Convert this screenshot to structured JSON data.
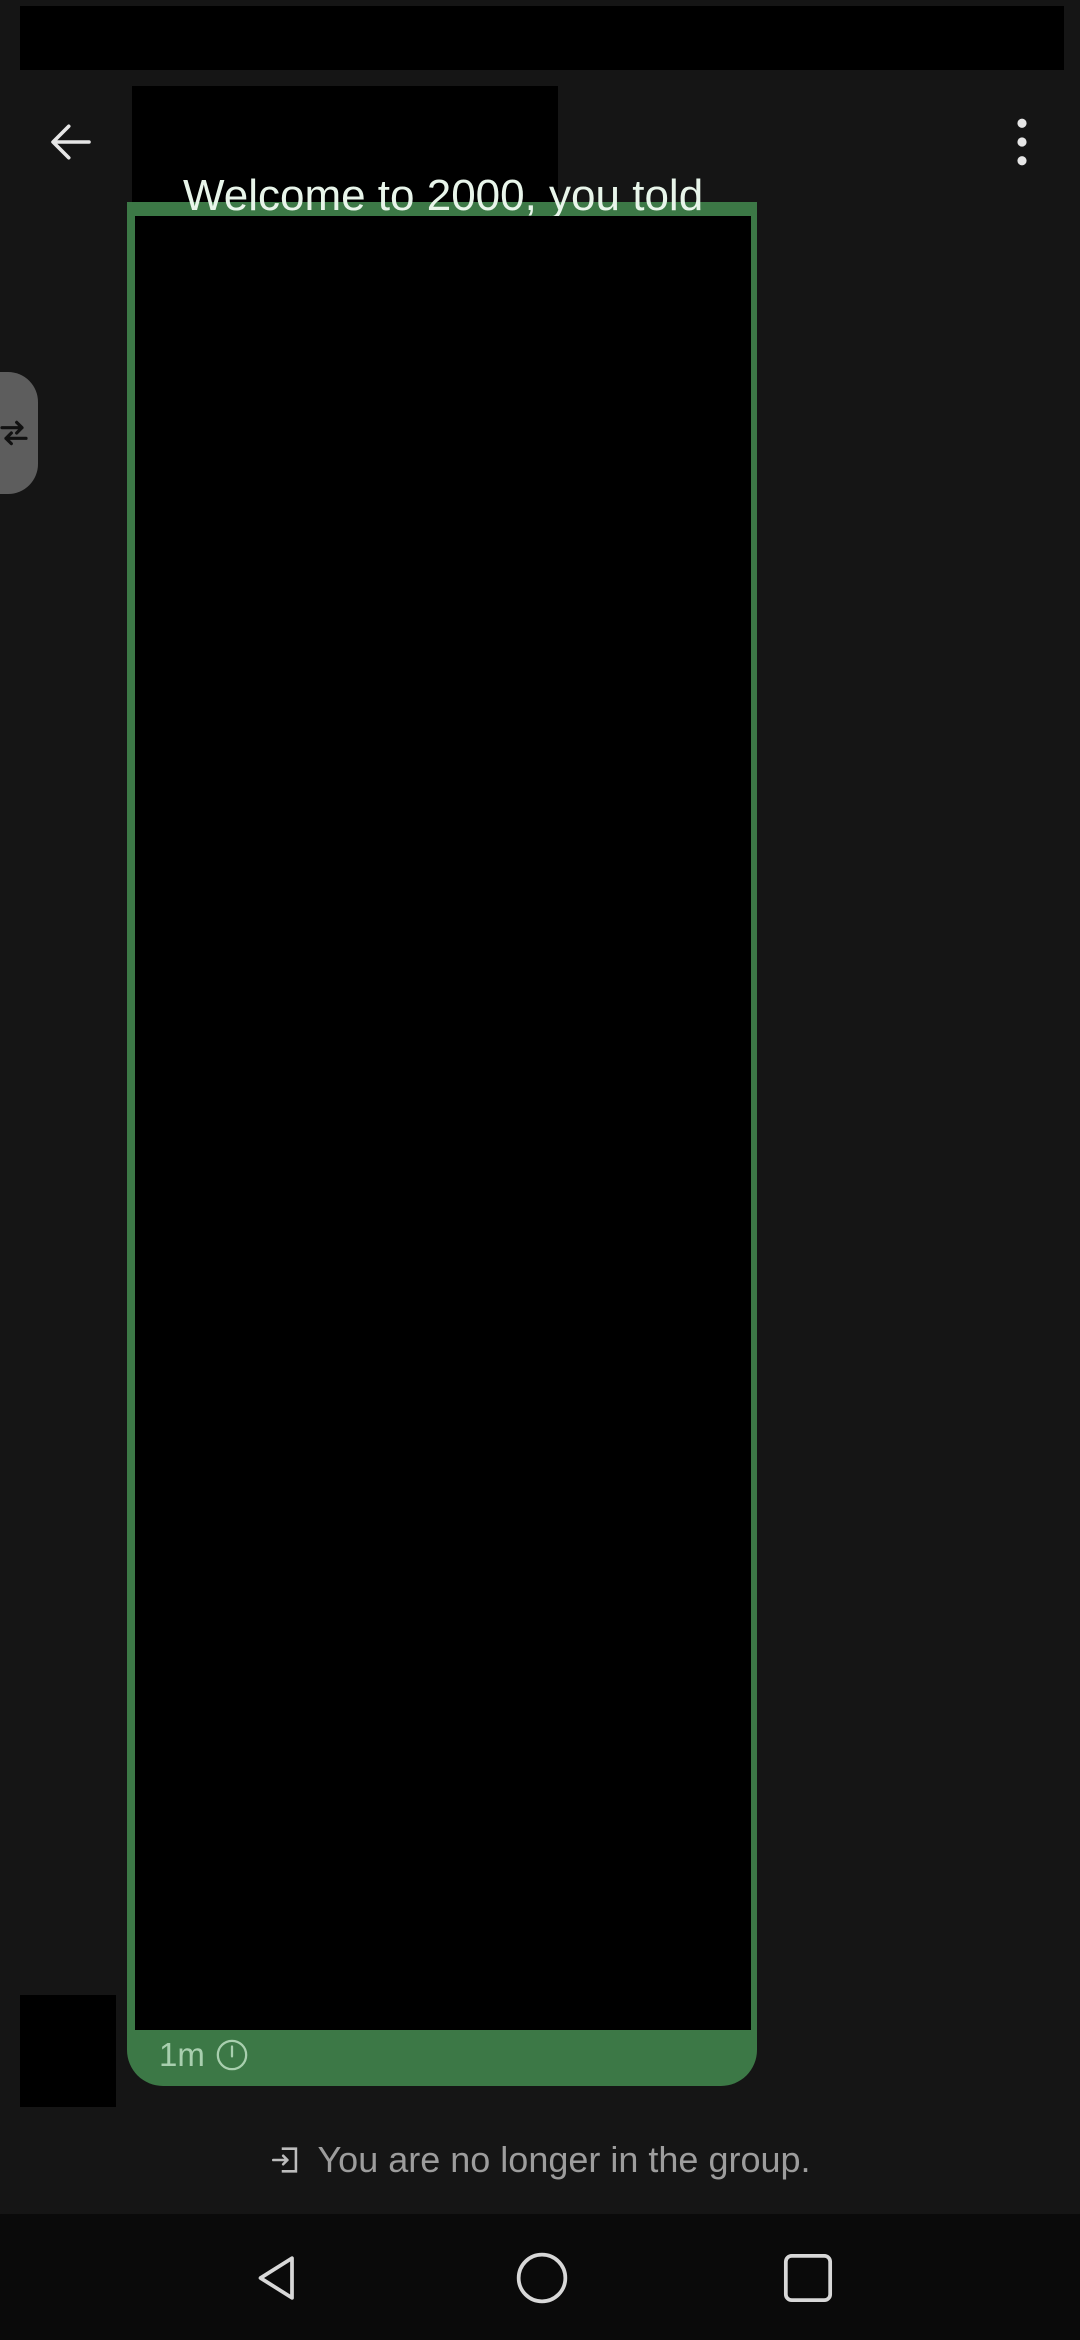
{
  "app_bar": {
    "back_icon": "arrow-left-icon",
    "menu_icon": "more-vert-icon"
  },
  "side_tab": {
    "icon": "swap-arrows-icon"
  },
  "message": {
    "text": "Welcome to 2000, you told",
    "timestamp": "1m",
    "timer_icon": "clock-icon",
    "bubble_color": "#3c7846"
  },
  "system_notice": {
    "icon": "exit-door-icon",
    "text": "You are no longer in the group."
  },
  "nav_bar": {
    "back_icon": "triangle-back-icon",
    "home_icon": "circle-home-icon",
    "recents_icon": "square-recents-icon"
  }
}
